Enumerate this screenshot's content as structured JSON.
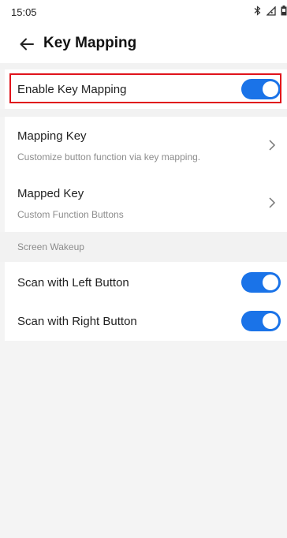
{
  "status_bar": {
    "time": "15:05",
    "icons": [
      "bluetooth-icon",
      "signal-icon",
      "battery-icon"
    ]
  },
  "header": {
    "title": "Key Mapping",
    "back_icon": "arrow-left-icon"
  },
  "settings": {
    "enable_key_mapping": {
      "label": "Enable Key Mapping",
      "enabled": true
    },
    "mapping_key": {
      "label": "Mapping Key",
      "description": "Customize button function via key mapping."
    },
    "mapped_key": {
      "label": "Mapped Key",
      "description": "Custom Function Buttons"
    },
    "screen_wakeup": {
      "section_title": "Screen Wakeup",
      "items": [
        {
          "label": "Scan with Left Button",
          "enabled": true
        },
        {
          "label": "Scan with Right Button",
          "enabled": true
        }
      ]
    }
  },
  "colors": {
    "toggle_on": "#1a73e8",
    "highlight": "#e0131b",
    "secondary_text": "#8c8c8c"
  }
}
